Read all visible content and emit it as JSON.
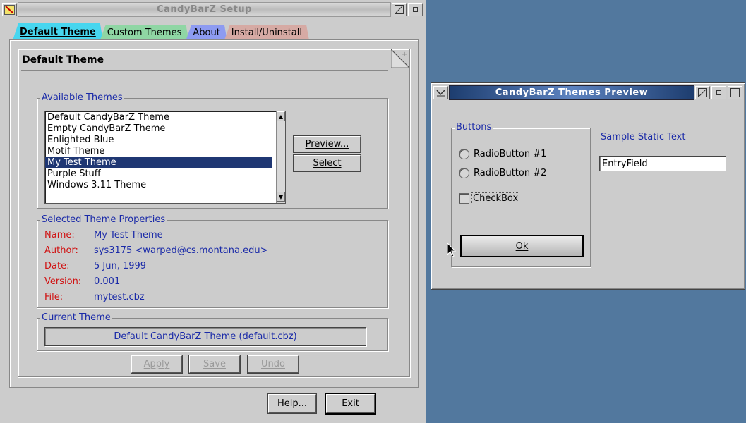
{
  "main_window": {
    "title": "CandyBarZ Setup",
    "tabs": [
      {
        "label": "Default Theme",
        "color": "#47d6ef",
        "active": true
      },
      {
        "label": "Custom Themes",
        "color": "#8fd6a4",
        "active": false
      },
      {
        "label": "About",
        "color": "#8d9bf1",
        "active": false
      },
      {
        "label": "Install/Uninstall",
        "color": "#d6aaa4",
        "active": false
      }
    ],
    "page_title": "Default Theme",
    "available_themes": {
      "label": "Available Themes",
      "items": [
        "Default CandyBarZ Theme",
        "Empty CandyBarZ Theme",
        "Enlighted Blue",
        "Motif Theme",
        "My Test Theme",
        "Purple Stuff",
        "Windows 3.11 Theme"
      ],
      "selected": "My Test Theme",
      "preview_button": "Preview...",
      "select_button": "Select"
    },
    "properties": {
      "label": "Selected Theme Properties",
      "name_key": "Name:",
      "name": "My Test Theme",
      "author_key": "Author:",
      "author": "sys3175 <warped@cs.montana.edu>",
      "date_key": "Date:",
      "date": "5 Jun, 1999",
      "version_key": "Version:",
      "version": "0.001",
      "file_key": "File:",
      "file": "mytest.cbz"
    },
    "current_theme": {
      "label": "Current Theme",
      "value": "Default CandyBarZ Theme (default.cbz)"
    },
    "actions": {
      "apply": "Apply",
      "save": "Save",
      "undo": "Undo"
    },
    "footer": {
      "help": "Help...",
      "exit": "Exit"
    }
  },
  "preview_window": {
    "title": "CandyBarZ Themes Preview",
    "buttons_group_label": "Buttons",
    "radio1": "RadioButton #1",
    "radio2": "RadioButton #2",
    "checkbox": "CheckBox",
    "ok": "Ok",
    "static_text": "Sample Static Text",
    "entry_field": "EntryField"
  },
  "colors": {
    "desktop": "#52789e",
    "label_blue": "#1a2aa8",
    "key_red": "#d01010",
    "selection": "#1f3773"
  }
}
